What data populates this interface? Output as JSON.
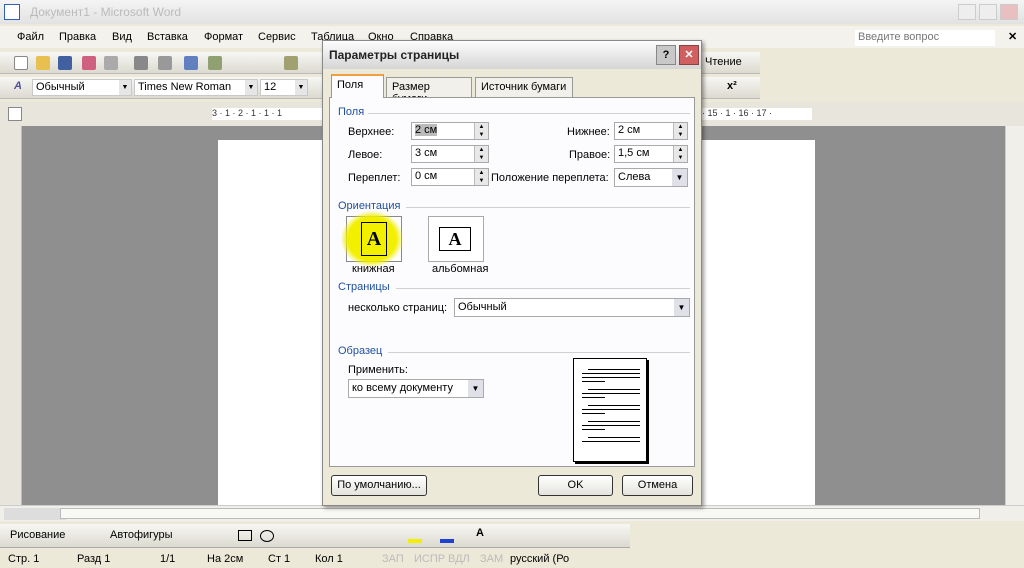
{
  "window": {
    "title": "Документ1 - Microsoft Word"
  },
  "menu": [
    "Файл",
    "Правка",
    "Вид",
    "Вставка",
    "Формат",
    "Сервис",
    "Таблица",
    "Окно",
    "Справка"
  ],
  "help_placeholder": "Введите вопрос",
  "toolbar": {
    "reading_label": "Чтение"
  },
  "format_toolbar": {
    "style": "Обычный",
    "font": "Times New Roman",
    "size": "12"
  },
  "ruler": {
    "left_ticks": "3 · 1 · 2 · 1 · 1 · 1",
    "right_ticks": "· 15 · 1 · 16 · 17 ·"
  },
  "dialog": {
    "title": "Параметры страницы",
    "help": "?",
    "tabs": [
      "Поля",
      "Размер бумаги",
      "Источник бумаги"
    ],
    "margins": {
      "group": "Поля",
      "top_label": "Верхнее:",
      "top": "2 см",
      "bottom_label": "Нижнее:",
      "bottom": "2 см",
      "left_label": "Левое:",
      "left": "3 см",
      "right_label": "Правое:",
      "right": "1,5 см",
      "gutter_label": "Переплет:",
      "gutter": "0 см",
      "gutter_pos_label": "Положение переплета:",
      "gutter_pos": "Слева"
    },
    "orientation": {
      "group": "Ориентация",
      "portrait": "книжная",
      "landscape": "альбомная",
      "selected": "portrait",
      "glyph": "A"
    },
    "pages": {
      "group": "Страницы",
      "multiple_label": "несколько страниц:",
      "multiple": "Обычный"
    },
    "preview": {
      "group": "Образец",
      "apply_label": "Применить:",
      "apply": "ко всему документу"
    },
    "buttons": {
      "default": "По умолчанию...",
      "ok": "OK",
      "cancel": "Отмена"
    }
  },
  "drawing": {
    "draw": "Рисование",
    "autoshapes": "Автофигуры"
  },
  "status": [
    "Стр. 1",
    "Разд 1",
    "1/1",
    "На 2см",
    "Ст 1",
    "Кол 1",
    "ЗАП",
    "ИСПР",
    "ВДЛ",
    "ЗАМ",
    "русский (Ро"
  ],
  "colors": {
    "highlight": "#f2ef00",
    "accent_tab": "#f0a040",
    "group_text": "#2050a0"
  }
}
